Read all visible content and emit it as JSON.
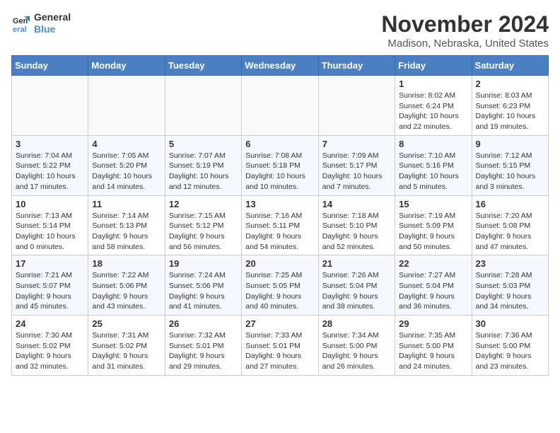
{
  "header": {
    "logo_line1": "General",
    "logo_line2": "Blue",
    "month_year": "November 2024",
    "location": "Madison, Nebraska, United States"
  },
  "weekdays": [
    "Sunday",
    "Monday",
    "Tuesday",
    "Wednesday",
    "Thursday",
    "Friday",
    "Saturday"
  ],
  "weeks": [
    [
      {
        "day": "",
        "info": ""
      },
      {
        "day": "",
        "info": ""
      },
      {
        "day": "",
        "info": ""
      },
      {
        "day": "",
        "info": ""
      },
      {
        "day": "",
        "info": ""
      },
      {
        "day": "1",
        "info": "Sunrise: 8:02 AM\nSunset: 6:24 PM\nDaylight: 10 hours\nand 22 minutes."
      },
      {
        "day": "2",
        "info": "Sunrise: 8:03 AM\nSunset: 6:23 PM\nDaylight: 10 hours\nand 19 minutes."
      }
    ],
    [
      {
        "day": "3",
        "info": "Sunrise: 7:04 AM\nSunset: 5:22 PM\nDaylight: 10 hours\nand 17 minutes."
      },
      {
        "day": "4",
        "info": "Sunrise: 7:05 AM\nSunset: 5:20 PM\nDaylight: 10 hours\nand 14 minutes."
      },
      {
        "day": "5",
        "info": "Sunrise: 7:07 AM\nSunset: 5:19 PM\nDaylight: 10 hours\nand 12 minutes."
      },
      {
        "day": "6",
        "info": "Sunrise: 7:08 AM\nSunset: 5:18 PM\nDaylight: 10 hours\nand 10 minutes."
      },
      {
        "day": "7",
        "info": "Sunrise: 7:09 AM\nSunset: 5:17 PM\nDaylight: 10 hours\nand 7 minutes."
      },
      {
        "day": "8",
        "info": "Sunrise: 7:10 AM\nSunset: 5:16 PM\nDaylight: 10 hours\nand 5 minutes."
      },
      {
        "day": "9",
        "info": "Sunrise: 7:12 AM\nSunset: 5:15 PM\nDaylight: 10 hours\nand 3 minutes."
      }
    ],
    [
      {
        "day": "10",
        "info": "Sunrise: 7:13 AM\nSunset: 5:14 PM\nDaylight: 10 hours\nand 0 minutes."
      },
      {
        "day": "11",
        "info": "Sunrise: 7:14 AM\nSunset: 5:13 PM\nDaylight: 9 hours\nand 58 minutes."
      },
      {
        "day": "12",
        "info": "Sunrise: 7:15 AM\nSunset: 5:12 PM\nDaylight: 9 hours\nand 56 minutes."
      },
      {
        "day": "13",
        "info": "Sunrise: 7:16 AM\nSunset: 5:11 PM\nDaylight: 9 hours\nand 54 minutes."
      },
      {
        "day": "14",
        "info": "Sunrise: 7:18 AM\nSunset: 5:10 PM\nDaylight: 9 hours\nand 52 minutes."
      },
      {
        "day": "15",
        "info": "Sunrise: 7:19 AM\nSunset: 5:09 PM\nDaylight: 9 hours\nand 50 minutes."
      },
      {
        "day": "16",
        "info": "Sunrise: 7:20 AM\nSunset: 5:08 PM\nDaylight: 9 hours\nand 47 minutes."
      }
    ],
    [
      {
        "day": "17",
        "info": "Sunrise: 7:21 AM\nSunset: 5:07 PM\nDaylight: 9 hours\nand 45 minutes."
      },
      {
        "day": "18",
        "info": "Sunrise: 7:22 AM\nSunset: 5:06 PM\nDaylight: 9 hours\nand 43 minutes."
      },
      {
        "day": "19",
        "info": "Sunrise: 7:24 AM\nSunset: 5:06 PM\nDaylight: 9 hours\nand 41 minutes."
      },
      {
        "day": "20",
        "info": "Sunrise: 7:25 AM\nSunset: 5:05 PM\nDaylight: 9 hours\nand 40 minutes."
      },
      {
        "day": "21",
        "info": "Sunrise: 7:26 AM\nSunset: 5:04 PM\nDaylight: 9 hours\nand 38 minutes."
      },
      {
        "day": "22",
        "info": "Sunrise: 7:27 AM\nSunset: 5:04 PM\nDaylight: 9 hours\nand 36 minutes."
      },
      {
        "day": "23",
        "info": "Sunrise: 7:28 AM\nSunset: 5:03 PM\nDaylight: 9 hours\nand 34 minutes."
      }
    ],
    [
      {
        "day": "24",
        "info": "Sunrise: 7:30 AM\nSunset: 5:02 PM\nDaylight: 9 hours\nand 32 minutes."
      },
      {
        "day": "25",
        "info": "Sunrise: 7:31 AM\nSunset: 5:02 PM\nDaylight: 9 hours\nand 31 minutes."
      },
      {
        "day": "26",
        "info": "Sunrise: 7:32 AM\nSunset: 5:01 PM\nDaylight: 9 hours\nand 29 minutes."
      },
      {
        "day": "27",
        "info": "Sunrise: 7:33 AM\nSunset: 5:01 PM\nDaylight: 9 hours\nand 27 minutes."
      },
      {
        "day": "28",
        "info": "Sunrise: 7:34 AM\nSunset: 5:00 PM\nDaylight: 9 hours\nand 26 minutes."
      },
      {
        "day": "29",
        "info": "Sunrise: 7:35 AM\nSunset: 5:00 PM\nDaylight: 9 hours\nand 24 minutes."
      },
      {
        "day": "30",
        "info": "Sunrise: 7:36 AM\nSunset: 5:00 PM\nDaylight: 9 hours\nand 23 minutes."
      }
    ]
  ]
}
